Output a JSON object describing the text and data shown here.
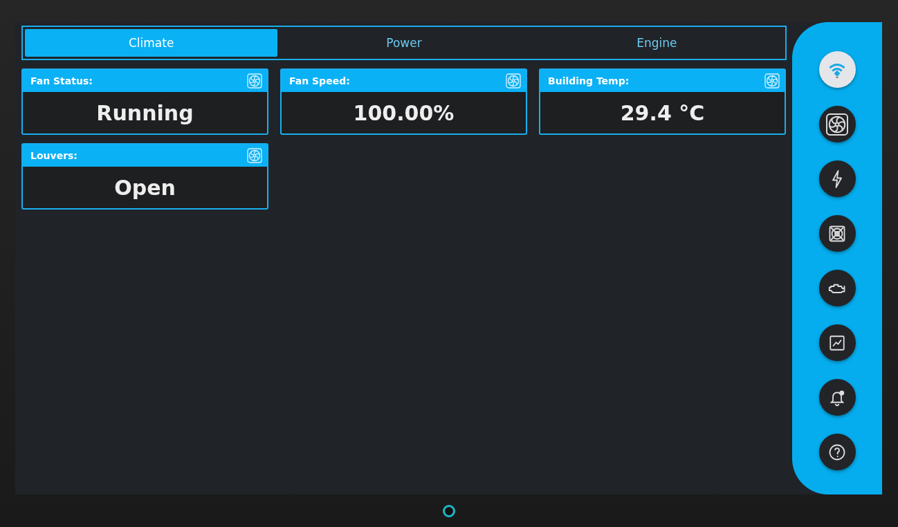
{
  "tabs": [
    {
      "label": "Climate",
      "selected": true
    },
    {
      "label": "Power",
      "selected": false
    },
    {
      "label": "Engine",
      "selected": false
    }
  ],
  "cards": [
    {
      "label": "Fan Status:",
      "value": "Running"
    },
    {
      "label": "Fan Speed:",
      "value": "100.00%"
    },
    {
      "label": "Building Temp:",
      "value": "29.4 °C"
    },
    {
      "label": "Louvers:",
      "value": "Open"
    }
  ],
  "nav": [
    {
      "kind": "logo",
      "selected": true
    },
    {
      "kind": "fan",
      "selected": false
    },
    {
      "kind": "bolt",
      "selected": false
    },
    {
      "kind": "grille",
      "selected": false
    },
    {
      "kind": "engine",
      "selected": false
    },
    {
      "kind": "chart",
      "selected": false
    },
    {
      "kind": "bell",
      "selected": false
    },
    {
      "kind": "help",
      "selected": false
    }
  ]
}
